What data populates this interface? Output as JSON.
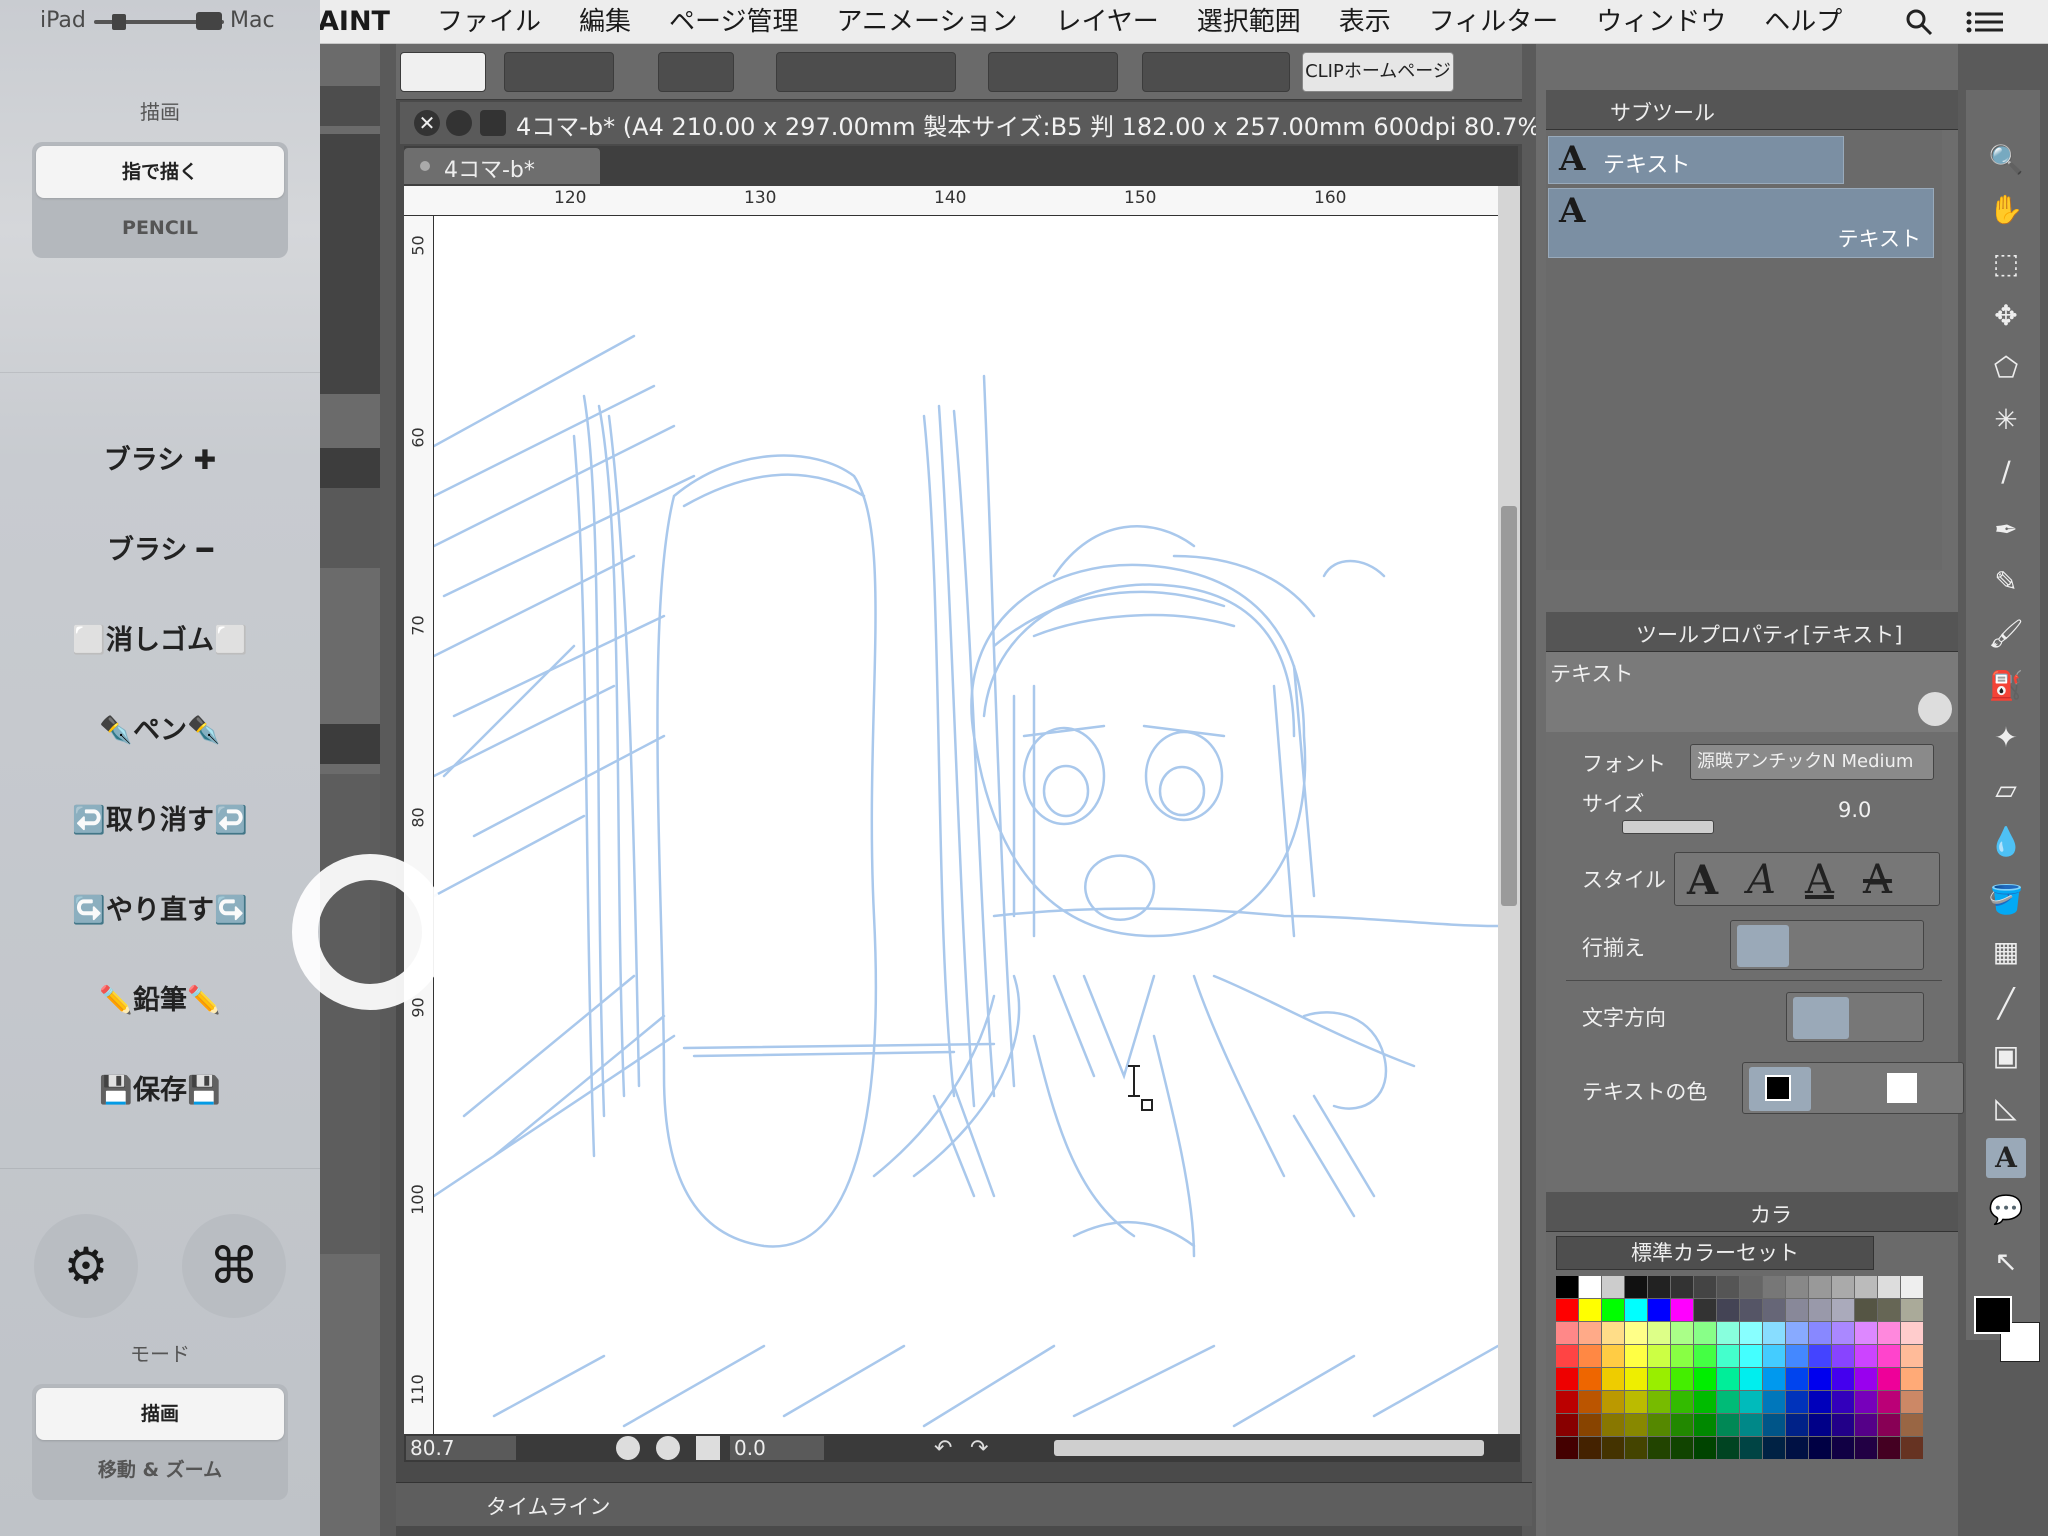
{
  "sidecar": {
    "toggle_left": "iPad",
    "toggle_right": "Mac",
    "draw_section_label": "描画",
    "draw_mode": {
      "selected": "指で描く",
      "other": "PENCIL"
    },
    "buttons": [
      {
        "label": "ブラシ ✚"
      },
      {
        "label": "ブラシ ━"
      },
      {
        "label": "⬜消しゴム⬜"
      },
      {
        "label": "✒️ペン✒️"
      },
      {
        "label": "↩️取り消す↩️"
      },
      {
        "label": "↪️やり直す↪️"
      },
      {
        "label": "✏️鉛筆✏️"
      },
      {
        "label": "💾保存💾"
      }
    ],
    "settings_icon": "gear-icon",
    "command_icon": "command-icon",
    "mode_label": "モード",
    "mode_seg": {
      "selected": "描画",
      "other": "移動 & ズーム"
    }
  },
  "menubar": {
    "app_name": "AINT",
    "items": [
      "ファイル",
      "編集",
      "ページ管理",
      "アニメーション",
      "レイヤー",
      "選択範囲",
      "表示",
      "フィルター",
      "ウィンドウ",
      "ヘルプ"
    ]
  },
  "toolbar": {
    "homepage_label": "CLIPホームページ"
  },
  "document": {
    "title": "4コマ-b* (A4 210.00 x 297.00mm 製本サイズ:B5 判 182.00 x 257.00mm 600dpi 80.7%)",
    "tab_label": "4コマ-b*",
    "ruler_h": [
      "120",
      "130",
      "140",
      "150",
      "160"
    ],
    "ruler_v": [
      "50",
      "60",
      "70",
      "80",
      "90",
      "100",
      "110"
    ],
    "zoom": "80.7",
    "angle": "0.0"
  },
  "timeline": {
    "label": "タイムライン"
  },
  "subtool": {
    "header": "サブツール",
    "group": "テキスト",
    "item": "テキスト"
  },
  "toolprop": {
    "header": "ツールプロパティ[テキスト]",
    "tool_name": "テキスト",
    "font_label": "フォント",
    "font_value": "源暎アンチックN Medium",
    "size_label": "サイズ",
    "size_value": "9.0",
    "style_label": "スタイル",
    "align_label": "行揃え",
    "direction_label": "文字方向",
    "color_label": "テキストの色"
  },
  "color": {
    "tab_label": "カラ",
    "set_name": "標準カラーセット"
  },
  "colors": {
    "sketch": "#a9c8ec",
    "panel": "#6d6d6d",
    "accent": "#7b8fa3"
  }
}
